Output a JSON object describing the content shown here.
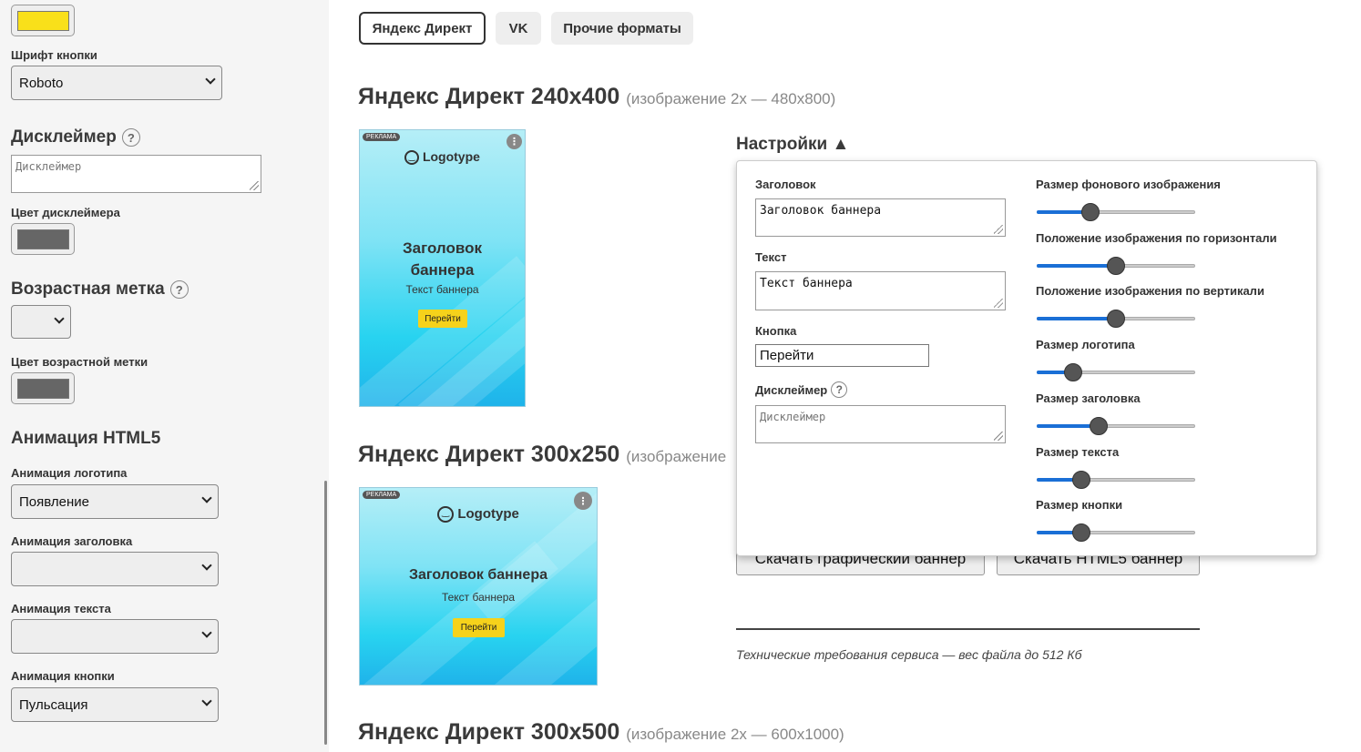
{
  "sidebar": {
    "button_color": "#f9e01a",
    "button_font_label": "Шрифт кнопки",
    "button_font_value": "Roboto",
    "disclaimer_heading": "Дисклеймер",
    "disclaimer_placeholder": "Дисклеймер",
    "disclaimer_color_label": "Цвет дисклеймера",
    "disclaimer_color": "#666666",
    "age_heading": "Возрастная метка",
    "age_value": "",
    "age_color_label": "Цвет возрастной метки",
    "age_color": "#666666",
    "animation_heading": "Анимация HTML5",
    "logo_anim_label": "Анимация логотипа",
    "logo_anim_value": "Появление",
    "title_anim_label": "Анимация заголовка",
    "title_anim_value": "",
    "text_anim_label": "Анимация текста",
    "text_anim_value": "",
    "button_anim_label": "Анимация кнопки",
    "button_anim_value": "Пульсация",
    "help_glyph": "?"
  },
  "tabs": [
    "Яндекс Директ",
    "VK",
    "Прочие форматы"
  ],
  "sections": [
    {
      "title": "Яндекс Директ 240x400",
      "sub": "(изображение 2x — 480x800)"
    },
    {
      "title": "Яндекс Директ 300x250",
      "sub": "(изображение"
    },
    {
      "title": "Яндекс Директ 300x500",
      "sub": "(изображение 2x — 600x1000)"
    }
  ],
  "banner": {
    "ad_tag": "РЕКЛАМА",
    "more_glyph": "⋮",
    "logo_text": "Logotype",
    "title": "Заголовок баннера",
    "text": "Текст баннера",
    "button": "Перейти"
  },
  "settings": {
    "heading": "Настройки ▲",
    "title_label": "Заголовок",
    "title_value": "Заголовок баннера",
    "text_label": "Текст",
    "text_value": "Текст баннера",
    "button_label": "Кнопка",
    "button_value": "Перейти",
    "disclaimer_label": "Дисклеймер",
    "disclaimer_placeholder": "Дисклеймер",
    "sliders": [
      {
        "label": "Размер фонового изображения",
        "value": 0.34
      },
      {
        "label": "Положение изображения по горизонтали",
        "value": 0.5
      },
      {
        "label": "Положение изображения по вертикали",
        "value": 0.5
      },
      {
        "label": "Размер логотипа",
        "value": 0.23
      },
      {
        "label": "Размер заголовка",
        "value": 0.39
      },
      {
        "label": "Размер текста",
        "value": 0.28
      },
      {
        "label": "Размер кнопки",
        "value": 0.28
      }
    ]
  },
  "downloads": {
    "graphic": "Скачать графический баннер",
    "html5": "Скачать HTML5 баннер"
  },
  "note": "Технические требования сервиса — вес файла до 512 Кб"
}
